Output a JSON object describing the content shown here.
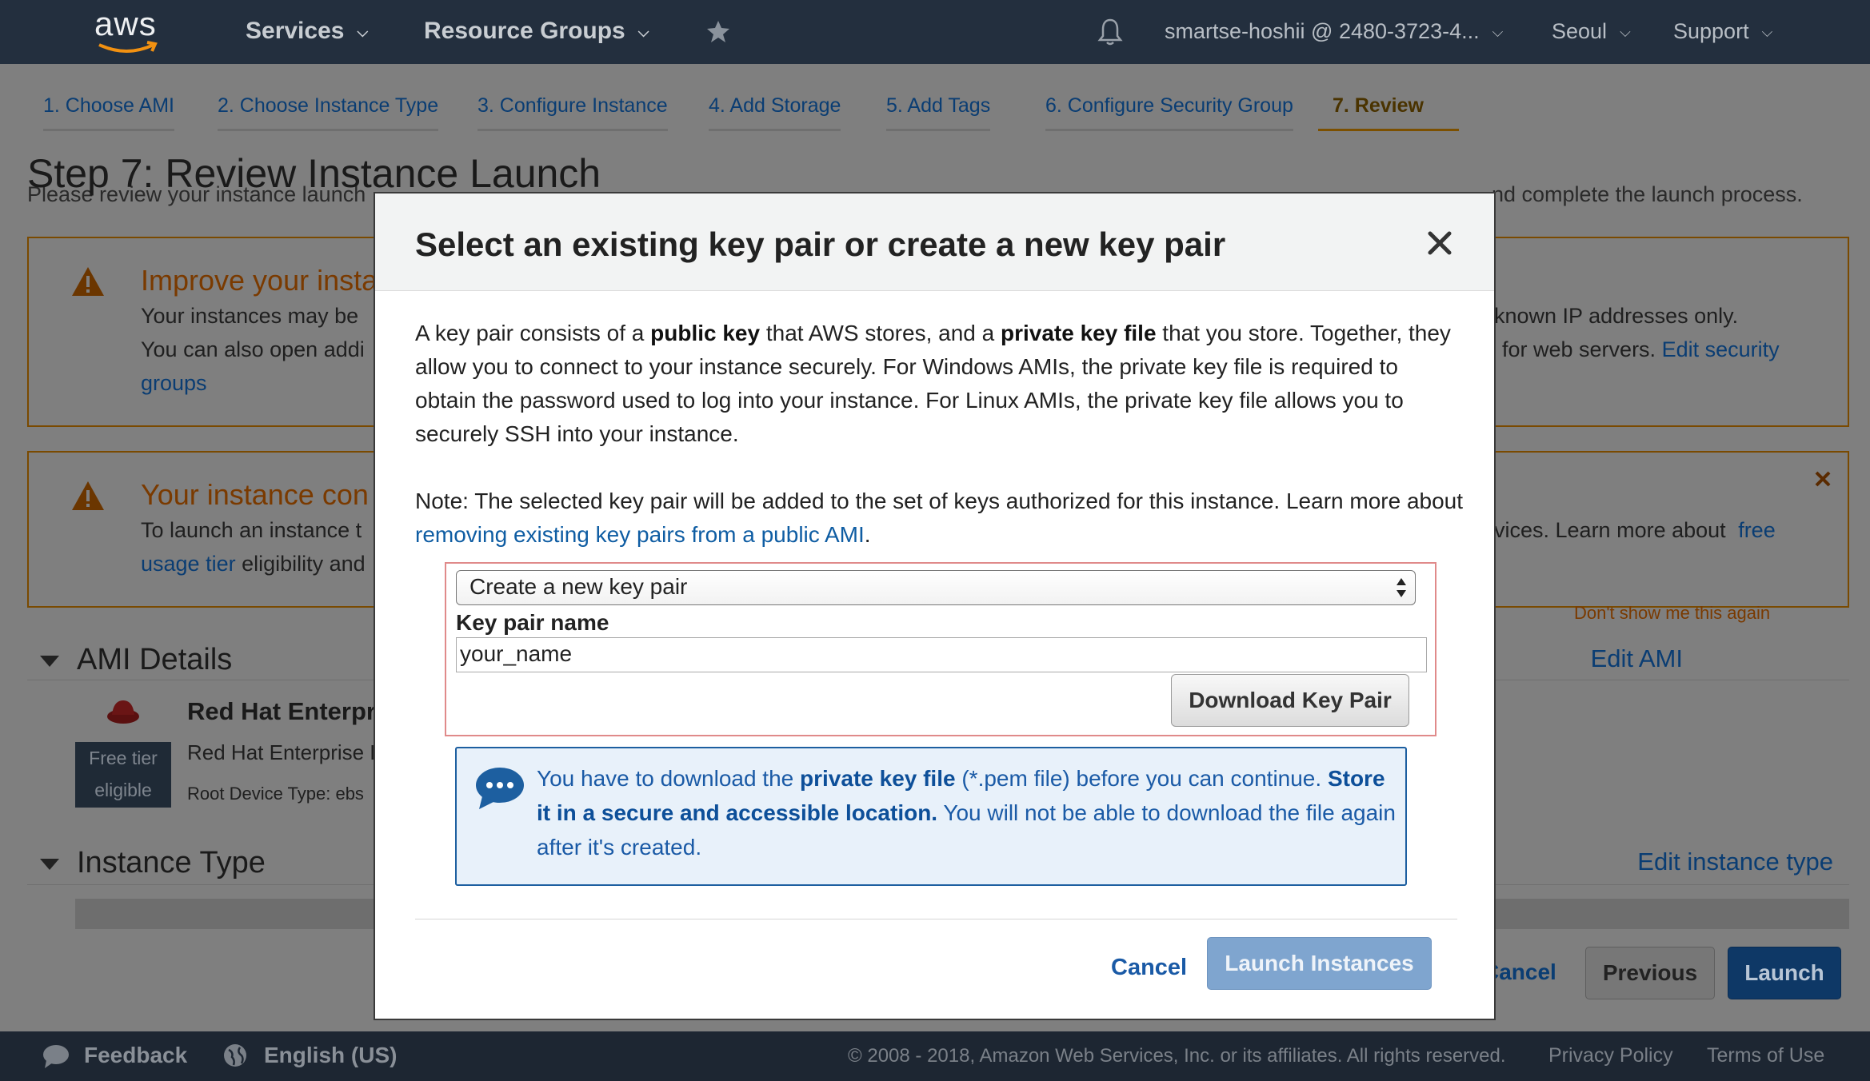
{
  "navbar": {
    "logo_text": "aws",
    "services": "Services",
    "resource_groups": "Resource Groups",
    "account": "smartse-hoshii @ 2480-3723-4...",
    "region": "Seoul",
    "support": "Support"
  },
  "wizard_tabs": [
    {
      "label": "1. Choose AMI"
    },
    {
      "label": "2. Choose Instance Type"
    },
    {
      "label": "3. Configure Instance"
    },
    {
      "label": "4. Add Storage"
    },
    {
      "label": "5. Add Tags"
    },
    {
      "label": "6. Configure Security Group"
    },
    {
      "label": "7. Review",
      "active": true
    }
  ],
  "page": {
    "title": "Step 7: Review Instance Launch",
    "subtitle_left": "Please review your instance launch",
    "subtitle_right": "nd complete the launch process.",
    "alert1": {
      "title": "Improve your insta",
      "line1_left": "Your instances may be",
      "line1_right": "known IP addresses only.",
      "line2_left": "You can also open addi",
      "line2_right": "for web servers.",
      "link_edit": "Edit security",
      "link_groups": "groups"
    },
    "alert2": {
      "title": "Your instance con",
      "line1_left": "To launch an instance t",
      "line1_right": "vices. Learn more about",
      "link_free": "free",
      "link_usage": "usage tier",
      "line2_rest": "eligibility and",
      "dont_show": "Don't show me this again"
    },
    "ami_section": "AMI Details",
    "edit_ami": "Edit AMI",
    "ami_name": "Red Hat Enterpr",
    "ami_desc": "Red Hat Enterprise L",
    "root_device": "Root Device Type: ebs",
    "free_tier_1": "Free tier",
    "free_tier_2": "eligible",
    "instance_section": "Instance Type",
    "edit_instance": "Edit instance type",
    "btn_cancel": "Cancel",
    "btn_previous": "Previous",
    "btn_launch": "Launch"
  },
  "footer": {
    "feedback": "Feedback",
    "language": "English (US)",
    "copyright": "© 2008 - 2018, Amazon Web Services, Inc. or its affiliates. All rights reserved.",
    "privacy": "Privacy Policy",
    "terms": "Terms of Use"
  },
  "modal": {
    "title": "Select an existing key pair or create a new key pair",
    "p1_a": "A key pair consists of a ",
    "p1_b": "public key",
    "p1_c": " that AWS stores, and a ",
    "p1_d": "private key file",
    "p1_e": " that you store. Together, they allow you to connect to your instance securely. For Windows AMIs, the private key file is required to obtain the password used to log into your instance. For Linux AMIs, the private key file allows you to securely SSH into your instance.",
    "note_a": "Note: The selected key pair will be added to the set of keys authorized for this instance. Learn more about ",
    "note_link": "removing existing key pairs from a public AMI",
    "note_end": ".",
    "select_value": "Create a new key pair",
    "keypair_label": "Key pair name",
    "keypair_value": "your_name",
    "download_btn": "Download Key Pair",
    "info_a": "You have to download the ",
    "info_b": "private key file",
    "info_c": " (*.pem file) before you can continue. ",
    "info_d": "Store it in a secure and accessible location.",
    "info_e": " You will not be able to download the file again after it's created.",
    "cancel": "Cancel",
    "launch": "Launch Instances"
  },
  "colors": {
    "navbar": "#232f3e",
    "footer": "#1d2632",
    "overlay": "#7f7f7f",
    "link": "#0f5da3",
    "launch_disabled": "#7fa5cf"
  }
}
